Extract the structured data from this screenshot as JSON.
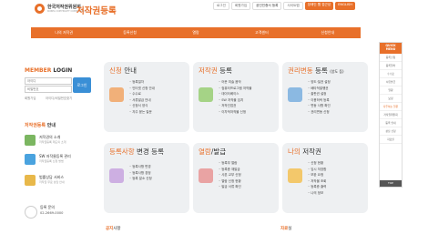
{
  "header": {
    "logo_ko": "한국저작권위원회",
    "logo_en": "KOREA COPYRIGHT COMMISSION",
    "site_title": "저작권등록"
  },
  "top_links": [
    "로그인",
    "회원가입",
    "공인인증서 등록",
    "사이트맵"
  ],
  "top_buttons": [
    "장애인 웹 접근성",
    "ENGLISH"
  ],
  "nav": [
    "나의 저작권",
    "등록신청",
    "열람",
    "고객센터",
    "신청안내"
  ],
  "login": {
    "title_m": "MEMBER",
    "title_rest": " LOGIN",
    "id_placeholder": "아이디",
    "pw_placeholder": "비밀번호",
    "button": "로그인",
    "links": [
      "회원가입",
      "아이디/비밀번호찾기"
    ]
  },
  "guide": {
    "title_prefix": "저작권등록",
    "title_suffix": " 안내",
    "items": [
      {
        "main": "저작권의 소개",
        "sub": "저작권등록 제도의 소개"
      },
      {
        "main": "SW 저작물등록 관리",
        "sub": "저작권등록 신청 방법"
      },
      {
        "main": "법률상담 서비스",
        "sub": "저작권 무료 상담 안내"
      }
    ],
    "phone_label": "등록 문의",
    "phone_number": "02-2669-0000"
  },
  "tiles": [
    {
      "title_hl": "신청",
      "title_rest": " 안내",
      "items": [
        "등록절차",
        "인터넷 신청 안내",
        "수수료",
        "서류발급 안내",
        "신청서 양식",
        "자주 묻는 질문"
      ]
    },
    {
      "title_hl": "저작권",
      "title_rest": " 등록",
      "items": [
        "어문 미술 음악",
        "컴퓨터프로그램 저작물",
        "데이터베이스",
        "SW 저작물 임치",
        "저작인접권",
        "이차적저작물 신청"
      ]
    },
    {
      "title_hl": "권리변동",
      "title_rest": " 등록",
      "title_small": "(양도 등)",
      "items": [
        "양도·질권 설정",
        "배타적발행권",
        "출판권 설정",
        "이용허락 등록",
        "변동 사항 확인",
        "권리변동 신청"
      ]
    },
    {
      "title_hl": "등록사항",
      "title_rest": " 변경 등록",
      "items": [
        "등록사항 변경",
        "등록사항 경정",
        "등록 말소 신청"
      ]
    },
    {
      "title_hl": "열람",
      "title_rest": "/발급",
      "items": [
        "등록부 열람",
        "등록증 재발급",
        "사본 교부 신청",
        "열람 신청 현황",
        "발급 서류 확인"
      ]
    },
    {
      "title_hl": "나의",
      "title_rest": " 저작권",
      "items": [
        "신청 현황",
        "임시 저장함",
        "보완 요청",
        "저작물 조회",
        "등록증 출력",
        "나의 정보"
      ]
    }
  ],
  "notice": {
    "prefix": "공지",
    "suffix": "사항"
  },
  "data_room": {
    "prefix": "자료",
    "suffix": "실"
  },
  "quick": {
    "head1": "QUICK",
    "head2": "MENU",
    "items": [
      "등록신청",
      "등록절차",
      "수수료",
      "서류발급",
      "열람",
      "보정",
      "자주하는 질문",
      "저작권위원회",
      "등록 안내",
      "상담 신청",
      "자료실"
    ],
    "top": "TOP"
  },
  "colors": {
    "accent": "#e8702a",
    "tile_bg": "#eef0f2",
    "button_blue": "#3a8fd6"
  }
}
